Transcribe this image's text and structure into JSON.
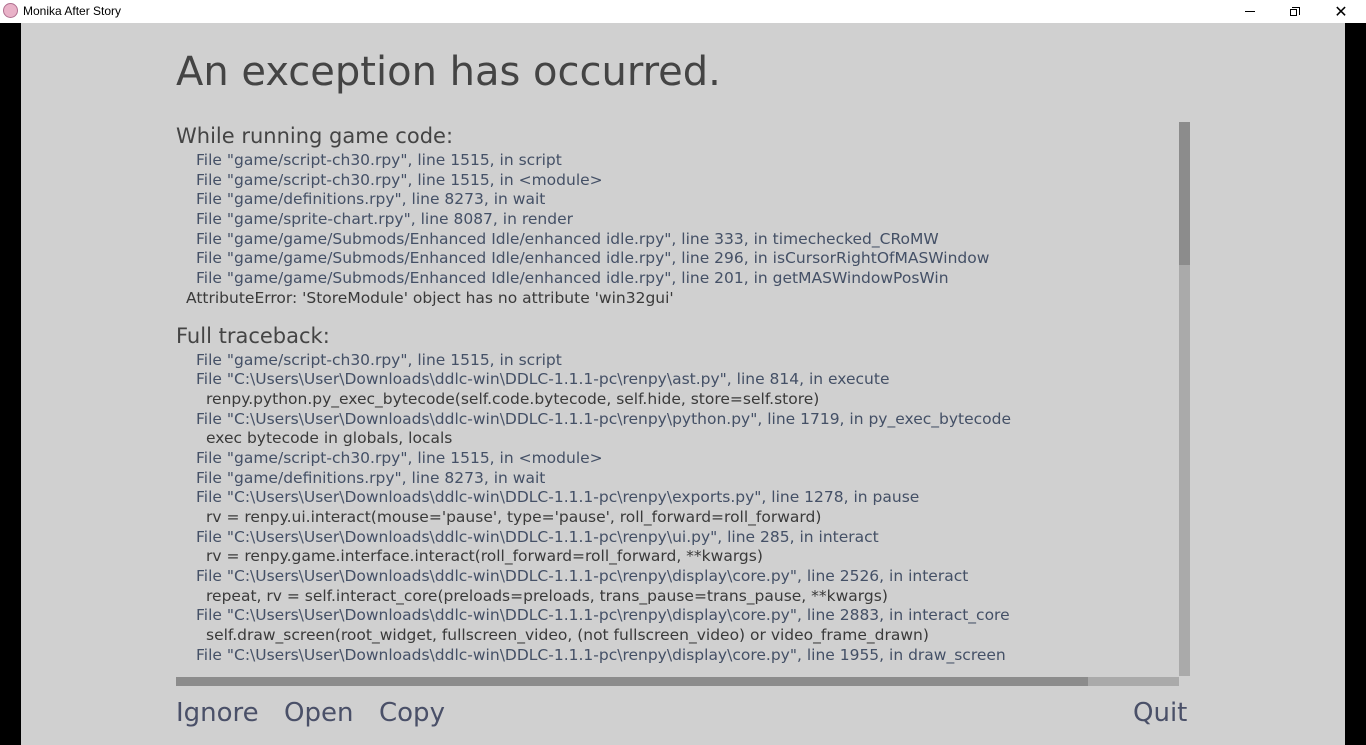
{
  "window": {
    "title": "Monika After Story",
    "icon": "monika-app-icon",
    "min_icon": "minimize-icon",
    "max_icon": "restore-icon",
    "close_icon": "close-icon",
    "close_glyph": "✕"
  },
  "error": {
    "heading": "An exception has occurred.",
    "game_code_title": "While running game code:",
    "game_code_lines": [
      {
        "kind": "file",
        "text": "File \"game/script-ch30.rpy\", line 1515, in script"
      },
      {
        "kind": "file",
        "text": "File \"game/script-ch30.rpy\", line 1515, in <module>"
      },
      {
        "kind": "file",
        "text": "File \"game/definitions.rpy\", line 8273, in wait"
      },
      {
        "kind": "file",
        "text": "File \"game/sprite-chart.rpy\", line 8087, in render"
      },
      {
        "kind": "file",
        "text": "File \"game/game/Submods/Enhanced Idle/enhanced idle.rpy\", line 333, in timechecked_CRoMW"
      },
      {
        "kind": "file",
        "text": "File \"game/game/Submods/Enhanced Idle/enhanced idle.rpy\", line 296, in isCursorRightOfMASWindow"
      },
      {
        "kind": "file",
        "text": "File \"game/game/Submods/Enhanced Idle/enhanced idle.rpy\", line 201, in getMASWindowPosWin"
      },
      {
        "kind": "err",
        "text": "AttributeError: 'StoreModule' object has no attribute 'win32gui'"
      }
    ],
    "full_traceback_title": "Full traceback:",
    "full_traceback_lines": [
      {
        "kind": "file",
        "text": "File \"game/script-ch30.rpy\", line 1515, in script"
      },
      {
        "kind": "file",
        "text": "File \"C:\\Users\\User\\Downloads\\ddlc-win\\DDLC-1.1.1-pc\\renpy\\ast.py\", line 814, in execute"
      },
      {
        "kind": "code",
        "text": "renpy.python.py_exec_bytecode(self.code.bytecode, self.hide, store=self.store)"
      },
      {
        "kind": "file",
        "text": "File \"C:\\Users\\User\\Downloads\\ddlc-win\\DDLC-1.1.1-pc\\renpy\\python.py\", line 1719, in py_exec_bytecode"
      },
      {
        "kind": "code",
        "text": "exec bytecode in globals, locals"
      },
      {
        "kind": "file",
        "text": "File \"game/script-ch30.rpy\", line 1515, in <module>"
      },
      {
        "kind": "file",
        "text": "File \"game/definitions.rpy\", line 8273, in wait"
      },
      {
        "kind": "file",
        "text": "File \"C:\\Users\\User\\Downloads\\ddlc-win\\DDLC-1.1.1-pc\\renpy\\exports.py\", line 1278, in pause"
      },
      {
        "kind": "code",
        "text": "rv = renpy.ui.interact(mouse='pause', type='pause', roll_forward=roll_forward)"
      },
      {
        "kind": "file",
        "text": "File \"C:\\Users\\User\\Downloads\\ddlc-win\\DDLC-1.1.1-pc\\renpy\\ui.py\", line 285, in interact"
      },
      {
        "kind": "code",
        "text": "rv = renpy.game.interface.interact(roll_forward=roll_forward, **kwargs)"
      },
      {
        "kind": "file",
        "text": "File \"C:\\Users\\User\\Downloads\\ddlc-win\\DDLC-1.1.1-pc\\renpy\\display\\core.py\", line 2526, in interact"
      },
      {
        "kind": "code",
        "text": "repeat, rv = self.interact_core(preloads=preloads, trans_pause=trans_pause, **kwargs)"
      },
      {
        "kind": "file",
        "text": "File \"C:\\Users\\User\\Downloads\\ddlc-win\\DDLC-1.1.1-pc\\renpy\\display\\core.py\", line 2883, in interact_core"
      },
      {
        "kind": "code",
        "text": "self.draw_screen(root_widget, fullscreen_video, (not fullscreen_video) or video_frame_drawn)"
      },
      {
        "kind": "file",
        "text": "File \"C:\\Users\\User\\Downloads\\ddlc-win\\DDLC-1.1.1-pc\\renpy\\display\\core.py\", line 1955, in draw_screen"
      }
    ]
  },
  "actions": {
    "ignore": "Ignore",
    "open": "Open",
    "copy": "Copy",
    "quit": "Quit"
  },
  "colors": {
    "panel_bg": "#d0d0d0",
    "file_text": "#445066",
    "code_text": "#3a3a3a",
    "action_text": "#4a5068"
  }
}
